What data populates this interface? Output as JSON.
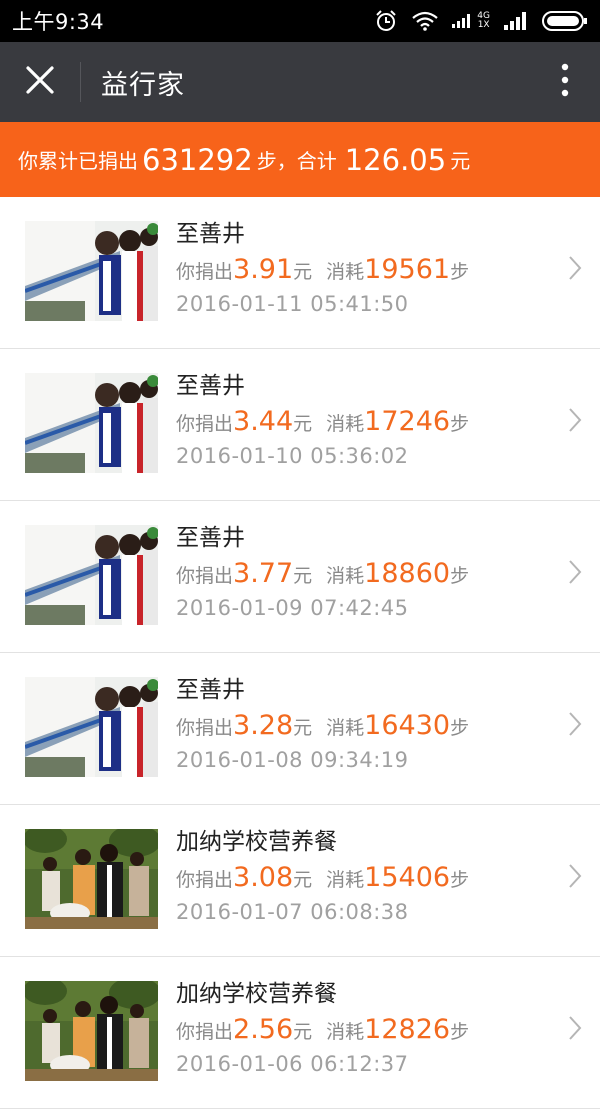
{
  "status_bar": {
    "time": "上午9:34",
    "network_label_top": "4G",
    "network_label_bottom": "1X"
  },
  "header": {
    "title": "益行家"
  },
  "summary": {
    "prefix": "你累计已捐出",
    "steps": "631292",
    "steps_unit": "步，合计",
    "amount": "126.05",
    "amount_unit": "元"
  },
  "labels": {
    "donated": "你捐出",
    "currency": "元",
    "consumed": "消耗",
    "steps": "步"
  },
  "donations": [
    {
      "project": "至善井",
      "amount": "3.91",
      "steps": "19561",
      "time": "2016-01-11 05:41:50",
      "image": "well-children-photo"
    },
    {
      "project": "至善井",
      "amount": "3.44",
      "steps": "17246",
      "time": "2016-01-10 05:36:02",
      "image": "well-children-photo"
    },
    {
      "project": "至善井",
      "amount": "3.77",
      "steps": "18860",
      "time": "2016-01-09 07:42:45",
      "image": "well-children-photo"
    },
    {
      "project": "至善井",
      "amount": "3.28",
      "steps": "16430",
      "time": "2016-01-08 09:34:19",
      "image": "well-children-photo"
    },
    {
      "project": "加纳学校营养餐",
      "amount": "3.08",
      "steps": "15406",
      "time": "2016-01-07 06:08:38",
      "image": "school-meal-photo"
    },
    {
      "project": "加纳学校营养餐",
      "amount": "2.56",
      "steps": "12826",
      "time": "2016-01-06 06:12:37",
      "image": "school-meal-photo"
    }
  ],
  "colors": {
    "accent": "#f7631a",
    "number": "#f26a1f",
    "titlebar": "#393a3f"
  }
}
